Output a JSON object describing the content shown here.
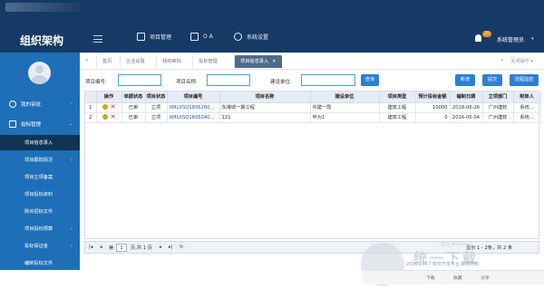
{
  "header": {
    "app_title": "组织架构",
    "nav": [
      {
        "label": "项目管理",
        "icon": "folder-icon"
      },
      {
        "label": "O A",
        "icon": "contact-card-icon"
      },
      {
        "label": "系统设置",
        "icon": "gear-icon"
      }
    ],
    "notification_count": "25",
    "user_label": "系统管理员"
  },
  "sidebar": {
    "items": [
      {
        "label": "我的审批",
        "icon": "person-icon"
      },
      {
        "label": "投标管理",
        "icon": "flag-icon"
      }
    ],
    "sub_items": [
      {
        "label": "项目信息录入",
        "active": true
      },
      {
        "label": "项目跟踪情况",
        "active": false
      },
      {
        "label": "项目立项备案",
        "active": false
      },
      {
        "label": "项目投标资料",
        "active": false
      },
      {
        "label": "购买招标文件",
        "active": false
      },
      {
        "label": "项目投标预算",
        "active": false
      },
      {
        "label": "投标保证金",
        "active": false
      },
      {
        "label": "编制投标文件",
        "active": false
      }
    ]
  },
  "tabs": [
    {
      "label": "首页"
    },
    {
      "label": "企业设置"
    },
    {
      "label": "我的审批"
    },
    {
      "label": "投标管理"
    },
    {
      "label": "项目信息录入",
      "active": true
    }
  ],
  "tab_close_ops": "关闭操作",
  "filter": {
    "project_no_label": "项目编号:",
    "project_name_label": "项目名称:",
    "build_unit_label": "建设单位:",
    "query_button": "查询",
    "add_button": "新增",
    "submit_button": "提交",
    "approval_button": "流程监控"
  },
  "table": {
    "columns": [
      "",
      "操作",
      "单据状态",
      "项目状态",
      "项目编号",
      "项目名称",
      "建设单位",
      "项目类型",
      "预计投标金额",
      "编制日期",
      "立项部门",
      "制单人"
    ],
    "rows": [
      [
        "1",
        "已审",
        "立项",
        "XMLXSQ1805260...",
        "东港城一期工程",
        "中建一局",
        "建筑工程",
        "10000",
        "2018-06-26",
        "广州建软",
        "系统..."
      ],
      [
        "2",
        "已审",
        "立项",
        "XMLXSQ1605040...",
        "121",
        "毕为1",
        "建筑工程",
        "0",
        "2016-05-04",
        "广州建软",
        "系统..."
      ]
    ]
  },
  "pager": {
    "page_label": "第",
    "page_value": "1",
    "page_total": "页,共 1 页",
    "summary": "显示 1 - 2条，共 2 条"
  },
  "watermark": {
    "text": "统一下载",
    "sub": "激活 Windows"
  },
  "footer": {
    "copyright": "2016-2017 软件开发平台 版权所有"
  },
  "bottom_strip": {
    "items": [
      "下载",
      "收藏",
      "分享"
    ]
  }
}
